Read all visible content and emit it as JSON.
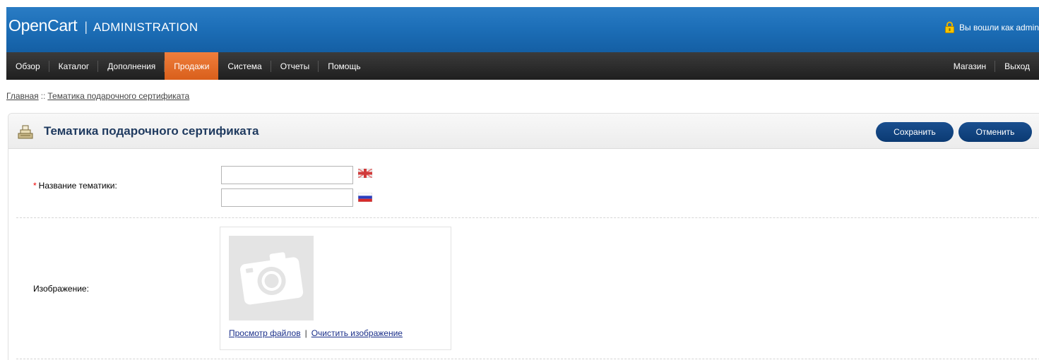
{
  "header": {
    "logo_main": "OpenCart",
    "logo_sep": "|",
    "logo_sub": "ADMINISTRATION",
    "login_text": "Вы вошли как admin"
  },
  "menu": {
    "items": [
      "Обзор",
      "Каталог",
      "Дополнения",
      "Продажи",
      "Система",
      "Отчеты",
      "Помощь"
    ],
    "active_index": 3,
    "right_items": [
      "Магазин",
      "Выход"
    ]
  },
  "breadcrumb": {
    "items": [
      "Главная",
      "Тематика подарочного сертификата"
    ],
    "separator": "::"
  },
  "panel": {
    "title": "Тематика подарочного сертификата",
    "save_label": "Сохранить",
    "cancel_label": "Отменить"
  },
  "form": {
    "name_label": "Название тематики:",
    "required_mark": "*",
    "name_values": [
      "",
      ""
    ],
    "languages": [
      "english-flag-icon",
      "russian-flag-icon"
    ],
    "image_label": "Изображение:",
    "browse_link": "Просмотр файлов",
    "link_sep": "|",
    "clear_link": "Очистить изображение"
  },
  "colors": {
    "header_blue": "#1d6fb8",
    "menu_dark": "#262626",
    "active_orange": "#e06a27",
    "button_blue": "#0f427f",
    "title_blue": "#1f3a5f"
  }
}
